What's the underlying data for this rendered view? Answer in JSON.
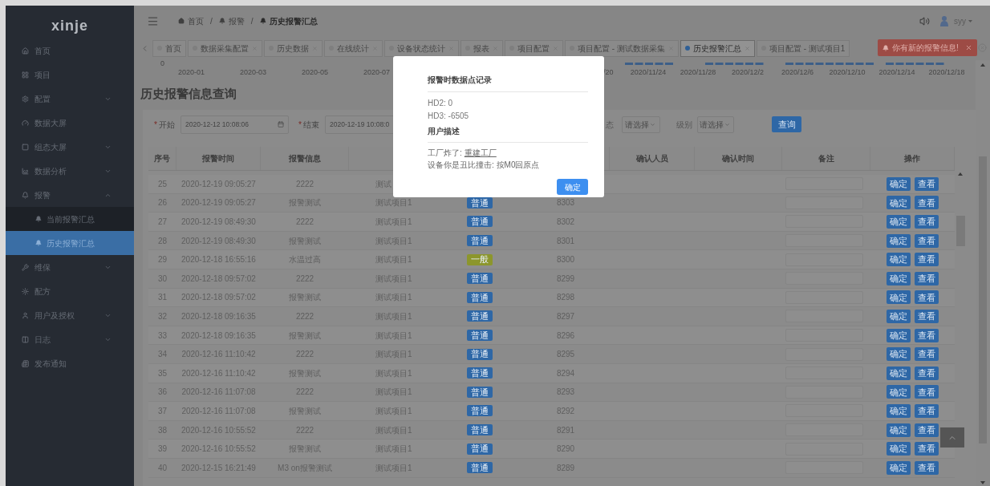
{
  "sidebar": {
    "logo": "xinje",
    "items": [
      {
        "label": "首页",
        "kind": "link",
        "selected": false
      },
      {
        "label": "项目",
        "kind": "link",
        "selected": false
      },
      {
        "label": "配置",
        "kind": "group",
        "expanded": false,
        "selected": false
      },
      {
        "label": "数据大屏",
        "kind": "link",
        "selected": false
      },
      {
        "label": "组态大屏",
        "kind": "group",
        "expanded": false,
        "selected": false
      },
      {
        "label": "数据分析",
        "kind": "group",
        "expanded": false,
        "selected": false
      },
      {
        "label": "报警",
        "kind": "group",
        "expanded": true,
        "selected": false,
        "children": [
          {
            "label": "当前报警汇总",
            "selected": false
          },
          {
            "label": "历史报警汇总",
            "selected": true
          }
        ]
      },
      {
        "label": "维保",
        "kind": "group",
        "expanded": false,
        "selected": false
      },
      {
        "label": "配方",
        "kind": "link",
        "selected": false
      },
      {
        "label": "用户及授权",
        "kind": "group",
        "expanded": false,
        "selected": false
      },
      {
        "label": "日志",
        "kind": "group",
        "expanded": false,
        "selected": false
      },
      {
        "label": "发布通知",
        "kind": "link",
        "selected": false
      }
    ]
  },
  "breadcrumb": [
    {
      "label": "首页",
      "current": false
    },
    {
      "separator": "/",
      "label": "报警",
      "current": false
    },
    {
      "separator": "/",
      "label": "历史报警汇总",
      "current": true
    }
  ],
  "user": {
    "name": "syy"
  },
  "tabs": [
    {
      "label": "首页",
      "closable": false,
      "selected": false
    },
    {
      "label": "数据采集配置",
      "closable": true,
      "selected": false
    },
    {
      "label": "历史数据",
      "closable": true,
      "selected": false
    },
    {
      "label": "在线统计",
      "closable": true,
      "selected": false
    },
    {
      "label": "设备状态统计",
      "closable": true,
      "selected": false
    },
    {
      "label": "报表",
      "closable": true,
      "selected": false
    },
    {
      "label": "项目配置",
      "closable": true,
      "selected": false
    },
    {
      "label": "项目配置 - 测试数据采集",
      "closable": true,
      "selected": false
    },
    {
      "label": "历史报警汇总",
      "closable": true,
      "selected": true
    },
    {
      "label": "项目配置 - 测试项目1",
      "closable": false,
      "selected": false
    }
  ],
  "toast": {
    "text": "你有新的报警信息!"
  },
  "chart_strip": {
    "y_tick": "0",
    "x_labels_left": [
      "2020-01",
      "2020-03",
      "2020-05",
      "2020-07"
    ],
    "x_labels_right": [
      "/20",
      "2020/11/24",
      "2020/11/28",
      "2020/12/2",
      "2020/12/6",
      "2020/12/10",
      "2020/12/14",
      "2020/12/18"
    ]
  },
  "page_title": "历史报警信息查询",
  "filters": {
    "start": {
      "label": "开始",
      "required": true,
      "required_mark": "*",
      "value": "2020-12-12 10:08:06"
    },
    "end": {
      "label": "结束",
      "required": true,
      "required_mark": "*",
      "value": "2020-12-19 10:08:0"
    },
    "status": {
      "label": "态",
      "placeholder": "请选择"
    },
    "level": {
      "label": "级别",
      "placeholder": "请选择"
    },
    "query_button": "查询"
  },
  "table": {
    "columns": [
      "序号",
      "报警时间",
      "报警信息",
      "",
      "",
      "",
      "确认人员",
      "确认时间",
      "备注",
      "操作"
    ],
    "rows": [
      {
        "no": "25",
        "time": "2020-12-19 09:05:27",
        "message": "2222",
        "project": "测试",
        "actions": [
          "确定",
          "查看"
        ]
      },
      {
        "no": "26",
        "time": "2020-12-19 09:05:27",
        "message": "报警测试",
        "project": "测试项目1",
        "tag": "普通",
        "color": "#2e67a6",
        "code": "8303",
        "actions": [
          "确定",
          "查看"
        ]
      },
      {
        "no": "27",
        "time": "2020-12-19 08:49:30",
        "message": "2222",
        "project": "测试项目1",
        "tag": "普通",
        "color": "#2e67a6",
        "code": "8302",
        "actions": [
          "确定",
          "查看"
        ]
      },
      {
        "no": "28",
        "time": "2020-12-19 08:49:30",
        "message": "报警测试",
        "project": "测试项目1",
        "tag": "普通",
        "color": "#2e67a6",
        "code": "8301",
        "actions": [
          "确定",
          "查看"
        ]
      },
      {
        "no": "29",
        "time": "2020-12-18 16:55:16",
        "message": "水温过高",
        "project": "测试项目1",
        "tag": "一般",
        "color": "#8c962c",
        "code": "8300",
        "actions": [
          "确定",
          "查看"
        ]
      },
      {
        "no": "30",
        "time": "2020-12-18 09:57:02",
        "message": "2222",
        "project": "测试项目1",
        "tag": "普通",
        "color": "#2e67a6",
        "code": "8299",
        "actions": [
          "确定",
          "查看"
        ]
      },
      {
        "no": "31",
        "time": "2020-12-18 09:57:02",
        "message": "报警测试",
        "project": "测试项目1",
        "tag": "普通",
        "color": "#2e67a6",
        "code": "8298",
        "actions": [
          "确定",
          "查看"
        ]
      },
      {
        "no": "32",
        "time": "2020-12-18 09:16:35",
        "message": "2222",
        "project": "测试项目1",
        "tag": "普通",
        "color": "#2e67a6",
        "code": "8297",
        "actions": [
          "确定",
          "查看"
        ]
      },
      {
        "no": "33",
        "time": "2020-12-18 09:16:35",
        "message": "报警测试",
        "project": "测试项目1",
        "tag": "普通",
        "color": "#2e67a6",
        "code": "8296",
        "actions": [
          "确定",
          "查看"
        ]
      },
      {
        "no": "34",
        "time": "2020-12-16 11:10:42",
        "message": "2222",
        "project": "测试项目1",
        "tag": "普通",
        "color": "#2e67a6",
        "code": "8295",
        "actions": [
          "确定",
          "查看"
        ]
      },
      {
        "no": "35",
        "time": "2020-12-16 11:10:42",
        "message": "报警测试",
        "project": "测试项目1",
        "tag": "普通",
        "color": "#2e67a6",
        "code": "8294",
        "actions": [
          "确定",
          "查看"
        ]
      },
      {
        "no": "36",
        "time": "2020-12-16 11:07:08",
        "message": "2222",
        "project": "测试项目1",
        "tag": "普通",
        "color": "#2e67a6",
        "code": "8293",
        "actions": [
          "确定",
          "查看"
        ]
      },
      {
        "no": "37",
        "time": "2020-12-16 11:07:08",
        "message": "报警测试",
        "project": "测试项目1",
        "tag": "普通",
        "color": "#2e67a6",
        "code": "8292",
        "actions": [
          "确定",
          "查看"
        ]
      },
      {
        "no": "38",
        "time": "2020-12-16 10:55:52",
        "message": "2222",
        "project": "测试项目1",
        "tag": "普通",
        "color": "#2e67a6",
        "code": "8291",
        "actions": [
          "确定",
          "查看"
        ]
      },
      {
        "no": "39",
        "time": "2020-12-16 10:55:52",
        "message": "报警测试",
        "project": "测试项目1",
        "tag": "普通",
        "color": "#2e67a6",
        "code": "8290",
        "actions": [
          "确定",
          "查看"
        ]
      },
      {
        "no": "40",
        "time": "2020-12-15 16:21:49",
        "message": "M3 on报警测试",
        "project": "测试项目1",
        "tag": "普通",
        "color": "#2e67a6",
        "code": "8289",
        "actions": [
          "确定",
          "查看"
        ]
      }
    ]
  },
  "modal": {
    "title": "报警时数据点记录",
    "values": [
      "HD2: 0",
      "HD3: -6505"
    ],
    "section": "用户描述",
    "lines": [
      {
        "text": "工厂炸了:",
        "link": "重建工厂"
      },
      {
        "text": "设备你是丑比撞击: 按M0回原点"
      }
    ],
    "button": "确定"
  }
}
